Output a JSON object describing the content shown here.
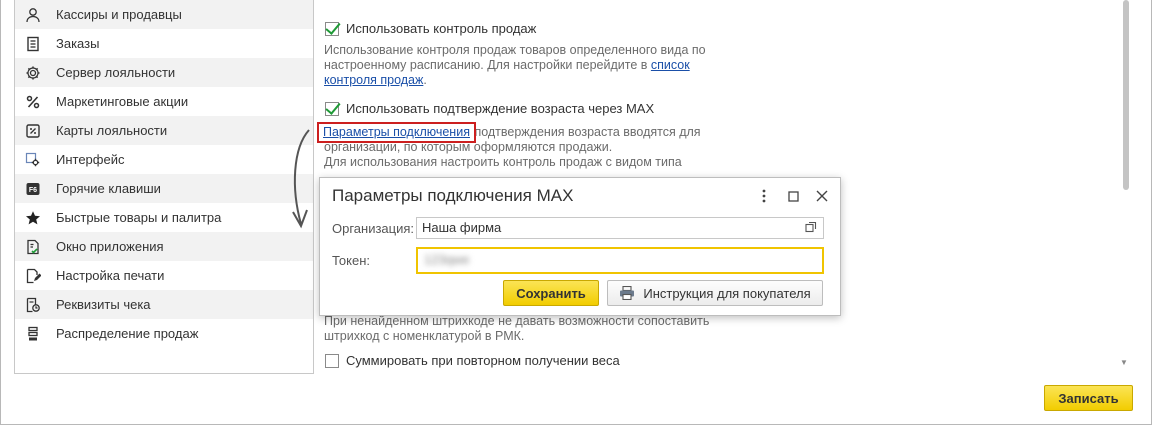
{
  "sidebar": {
    "items": [
      {
        "label": "Кассиры и продавцы",
        "icon": "user-icon"
      },
      {
        "label": "Заказы",
        "icon": "document-list-icon"
      },
      {
        "label": "Сервер лояльности",
        "icon": "gear-icon"
      },
      {
        "label": "Маркетинговые акции",
        "icon": "percent-icon"
      },
      {
        "label": "Карты лояльности",
        "icon": "discount-card-icon"
      },
      {
        "label": "Интерфейс",
        "icon": "interface-gear-icon"
      },
      {
        "label": "Горячие клавиши",
        "icon": "function-key-icon"
      },
      {
        "label": "Быстрые товары и палитра",
        "icon": "star-icon"
      },
      {
        "label": "Окно приложения",
        "icon": "app-window-icon"
      },
      {
        "label": "Настройка печати",
        "icon": "print-settings-icon"
      },
      {
        "label": "Реквизиты чека",
        "icon": "receipt-details-icon"
      },
      {
        "label": "Распределение продаж",
        "icon": "sales-distribution-icon"
      }
    ]
  },
  "settings": {
    "sales_control": {
      "label": "Использовать контроль продаж",
      "checked": true,
      "desc_line1": "Использование контроля продаж товаров определенного вида по",
      "desc_line2_prefix": "настроенному расписанию. Для настройки перейдите в ",
      "desc_link_a": "список",
      "desc_link_b": "контроля продаж",
      "desc_suffix": "."
    },
    "age_verification": {
      "label": "Использовать подтверждение возраста через MAX",
      "checked": true,
      "params_link": "Параметры подключения",
      "desc_line1_rest": " подтверждения возраста вводятся для",
      "desc_line2": "организации, по которым оформляются продажи.",
      "desc_line3": "Для использования настроить контроль продаж с видом типа"
    },
    "barcode": {
      "desc_line1": "При ненайденном штрихкоде не давать возможности сопоставить",
      "desc_line2": "штрихкод с номенклатурой в РМК."
    },
    "sum_weight": {
      "label": "Суммировать при повторном получении веса",
      "checked": false
    }
  },
  "dialog": {
    "title": "Параметры подключения MAX",
    "org_label": "Организация:",
    "org_value": "Наша фирма",
    "token_label": "Токен:",
    "token_value": "123qwe",
    "save_label": "Сохранить",
    "instruction_label": "Инструкция для покупателя"
  },
  "footer": {
    "record_label": "Записать"
  },
  "colors": {
    "accent_yellow": "#f2cd00",
    "link_blue": "#1a4fa8",
    "highlight_red": "#cc1f1f",
    "check_green": "#1e9a36"
  }
}
